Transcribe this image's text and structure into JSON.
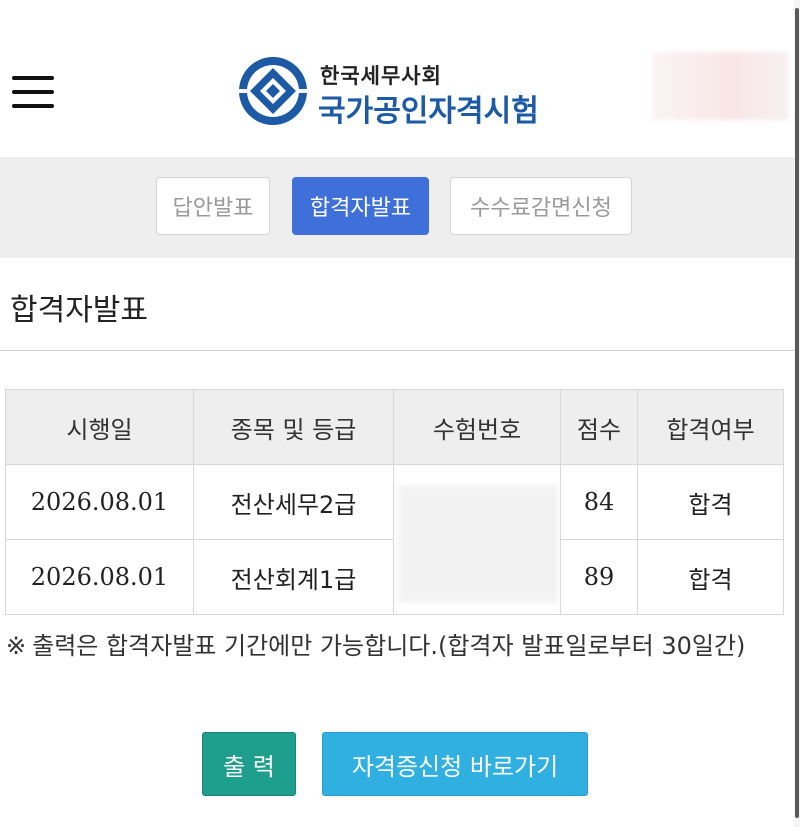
{
  "header": {
    "logo_small": "한국세무사회",
    "logo_big": "국가공인자격시험"
  },
  "tabs": [
    {
      "label": "답안발표",
      "active": false
    },
    {
      "label": "합격자발표",
      "active": true
    },
    {
      "label": "수수료감면신청",
      "active": false
    }
  ],
  "section": {
    "title": "합격자발표"
  },
  "table": {
    "headers": [
      "시행일",
      "종목 및 등급",
      "수험번호",
      "점수",
      "합격여부"
    ],
    "rows": [
      {
        "date": "2026.08.01",
        "subject": "전산세무2급",
        "score": "84",
        "result": "합격"
      },
      {
        "date": "2026.08.01",
        "subject": "전산회계1급",
        "score": "89",
        "result": "합격"
      }
    ]
  },
  "notice": {
    "mark": "※",
    "text": "출력은 합격자발표 기간에만 가능합니다.(합격자 발표일로부터 30일간)"
  },
  "buttons": {
    "print": "출 력",
    "certificate": "자격증신청 바로가기"
  },
  "colors": {
    "brand_blue": "#1c5aa6",
    "active_tab": "#3f6fd8",
    "print_button": "#1e9e8d",
    "certificate_button": "#2fb0e0"
  },
  "icons": {
    "menu": "hamburger-menu-icon",
    "logo": "diamond-emblem-icon"
  }
}
